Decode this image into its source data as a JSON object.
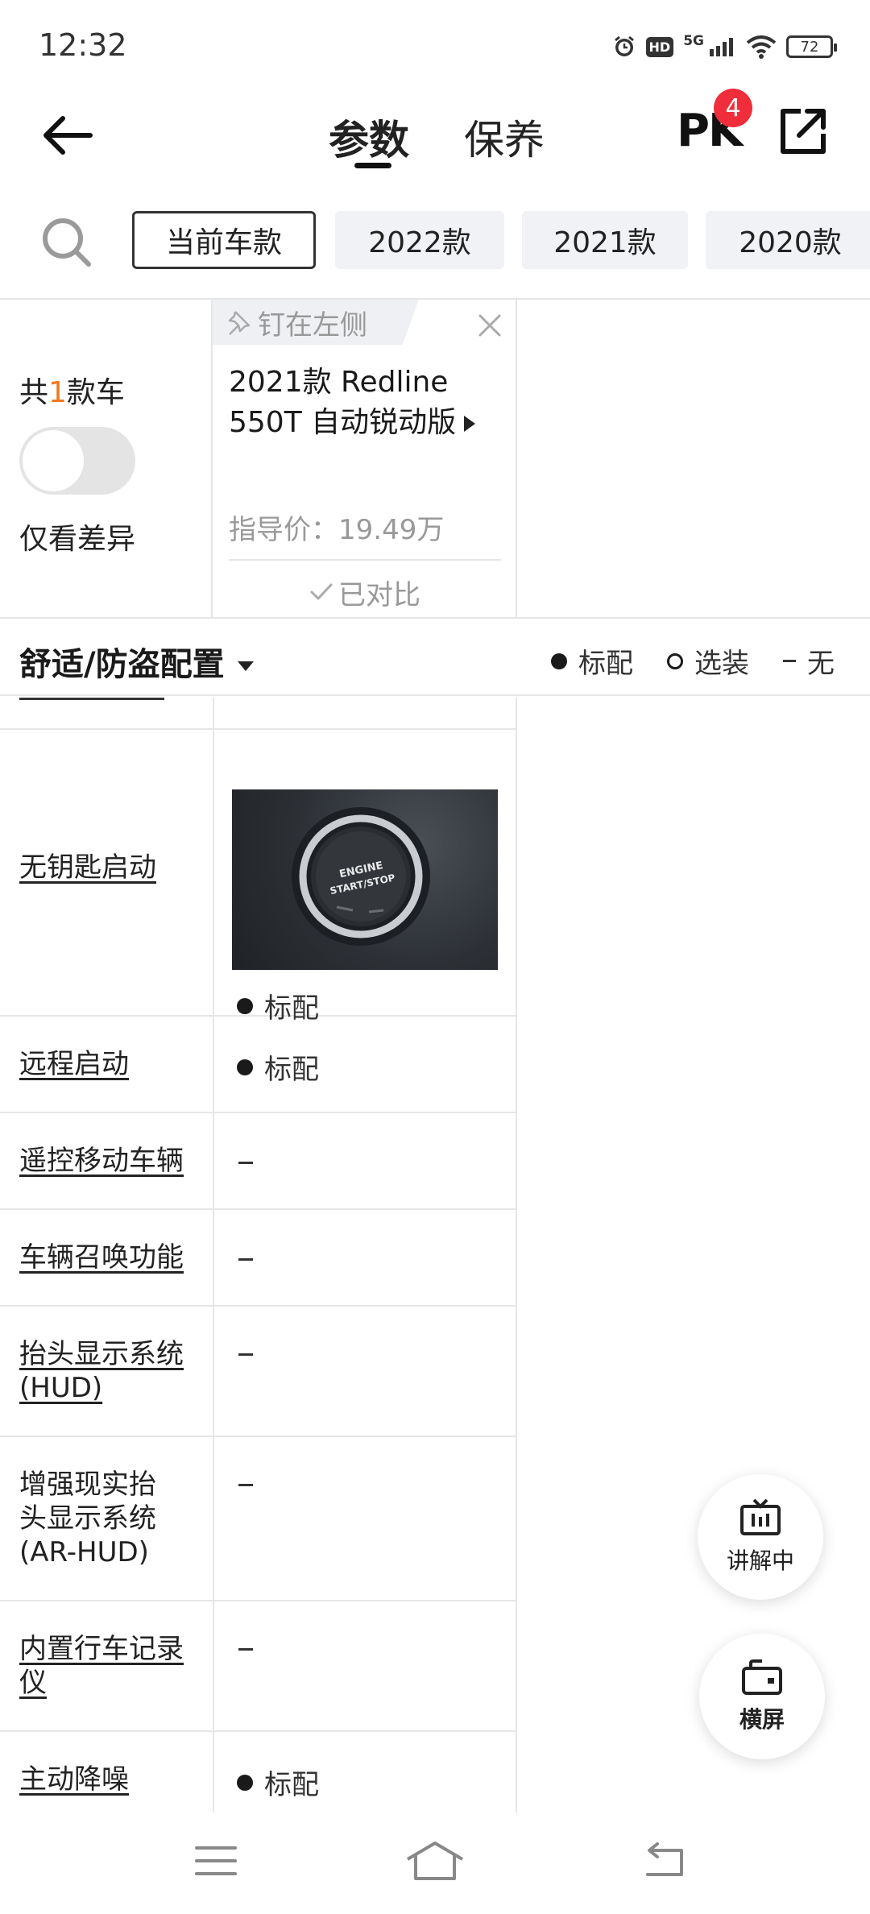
{
  "status_bar": {
    "time": "12:32",
    "network": "5G",
    "hd": "HD",
    "battery": "72",
    "icons": [
      "alarm-icon",
      "hd-icon",
      "signal-icon",
      "wifi-icon",
      "battery-icon"
    ]
  },
  "header": {
    "tabs": [
      {
        "label": "参数",
        "active": true
      },
      {
        "label": "保养",
        "active": false
      }
    ],
    "pk_label": "PK",
    "pk_count": "4",
    "icons": [
      "back-arrow-icon",
      "share-icon"
    ]
  },
  "year_filter": {
    "chips": [
      {
        "label": "当前车款",
        "active": true
      },
      {
        "label": "2022款",
        "active": false
      },
      {
        "label": "2021款",
        "active": false
      },
      {
        "label": "2020款",
        "active": false
      }
    ]
  },
  "summary": {
    "count_prefix": "共",
    "count": "1",
    "count_suffix": "款车",
    "diff_only_label": "仅看差异",
    "diff_only_on": false
  },
  "car_card": {
    "pin_label": "钉在左侧",
    "name": "2021款 Redline 550T 自动锐动版",
    "price": "指导价：19.49万",
    "status": "已对比"
  },
  "section": {
    "title": "舒适/防盗配置",
    "legend": {
      "standard": "标配",
      "optional": "选装",
      "none": "无"
    }
  },
  "specs": [
    {
      "label": "无钥匙启动",
      "value": "标配",
      "type": "standard",
      "link": true,
      "image": "engine-start-stop-button",
      "image_text": "ENGINE START/STOP"
    },
    {
      "label": "远程启动",
      "value": "标配",
      "type": "standard",
      "link": true
    },
    {
      "label": "遥控移动车辆",
      "value": "–",
      "type": "none",
      "link": true
    },
    {
      "label": "车辆召唤功能",
      "value": "–",
      "type": "none",
      "link": true
    },
    {
      "label": "抬头显示系统(HUD)",
      "value": "–",
      "type": "none",
      "link": true
    },
    {
      "label": "增强现实抬头显示系统(AR-HUD)",
      "value": "–",
      "type": "none",
      "link": false
    },
    {
      "label": "内置行车记录仪",
      "value": "–",
      "type": "none",
      "link": true
    },
    {
      "label": "主动降噪",
      "value": "标配",
      "type": "standard",
      "link": true
    }
  ],
  "floating": {
    "explain_label": "讲解中",
    "landscape_label": "横屏"
  },
  "bottom_nav": [
    "menu-icon",
    "home-icon",
    "back-icon"
  ]
}
